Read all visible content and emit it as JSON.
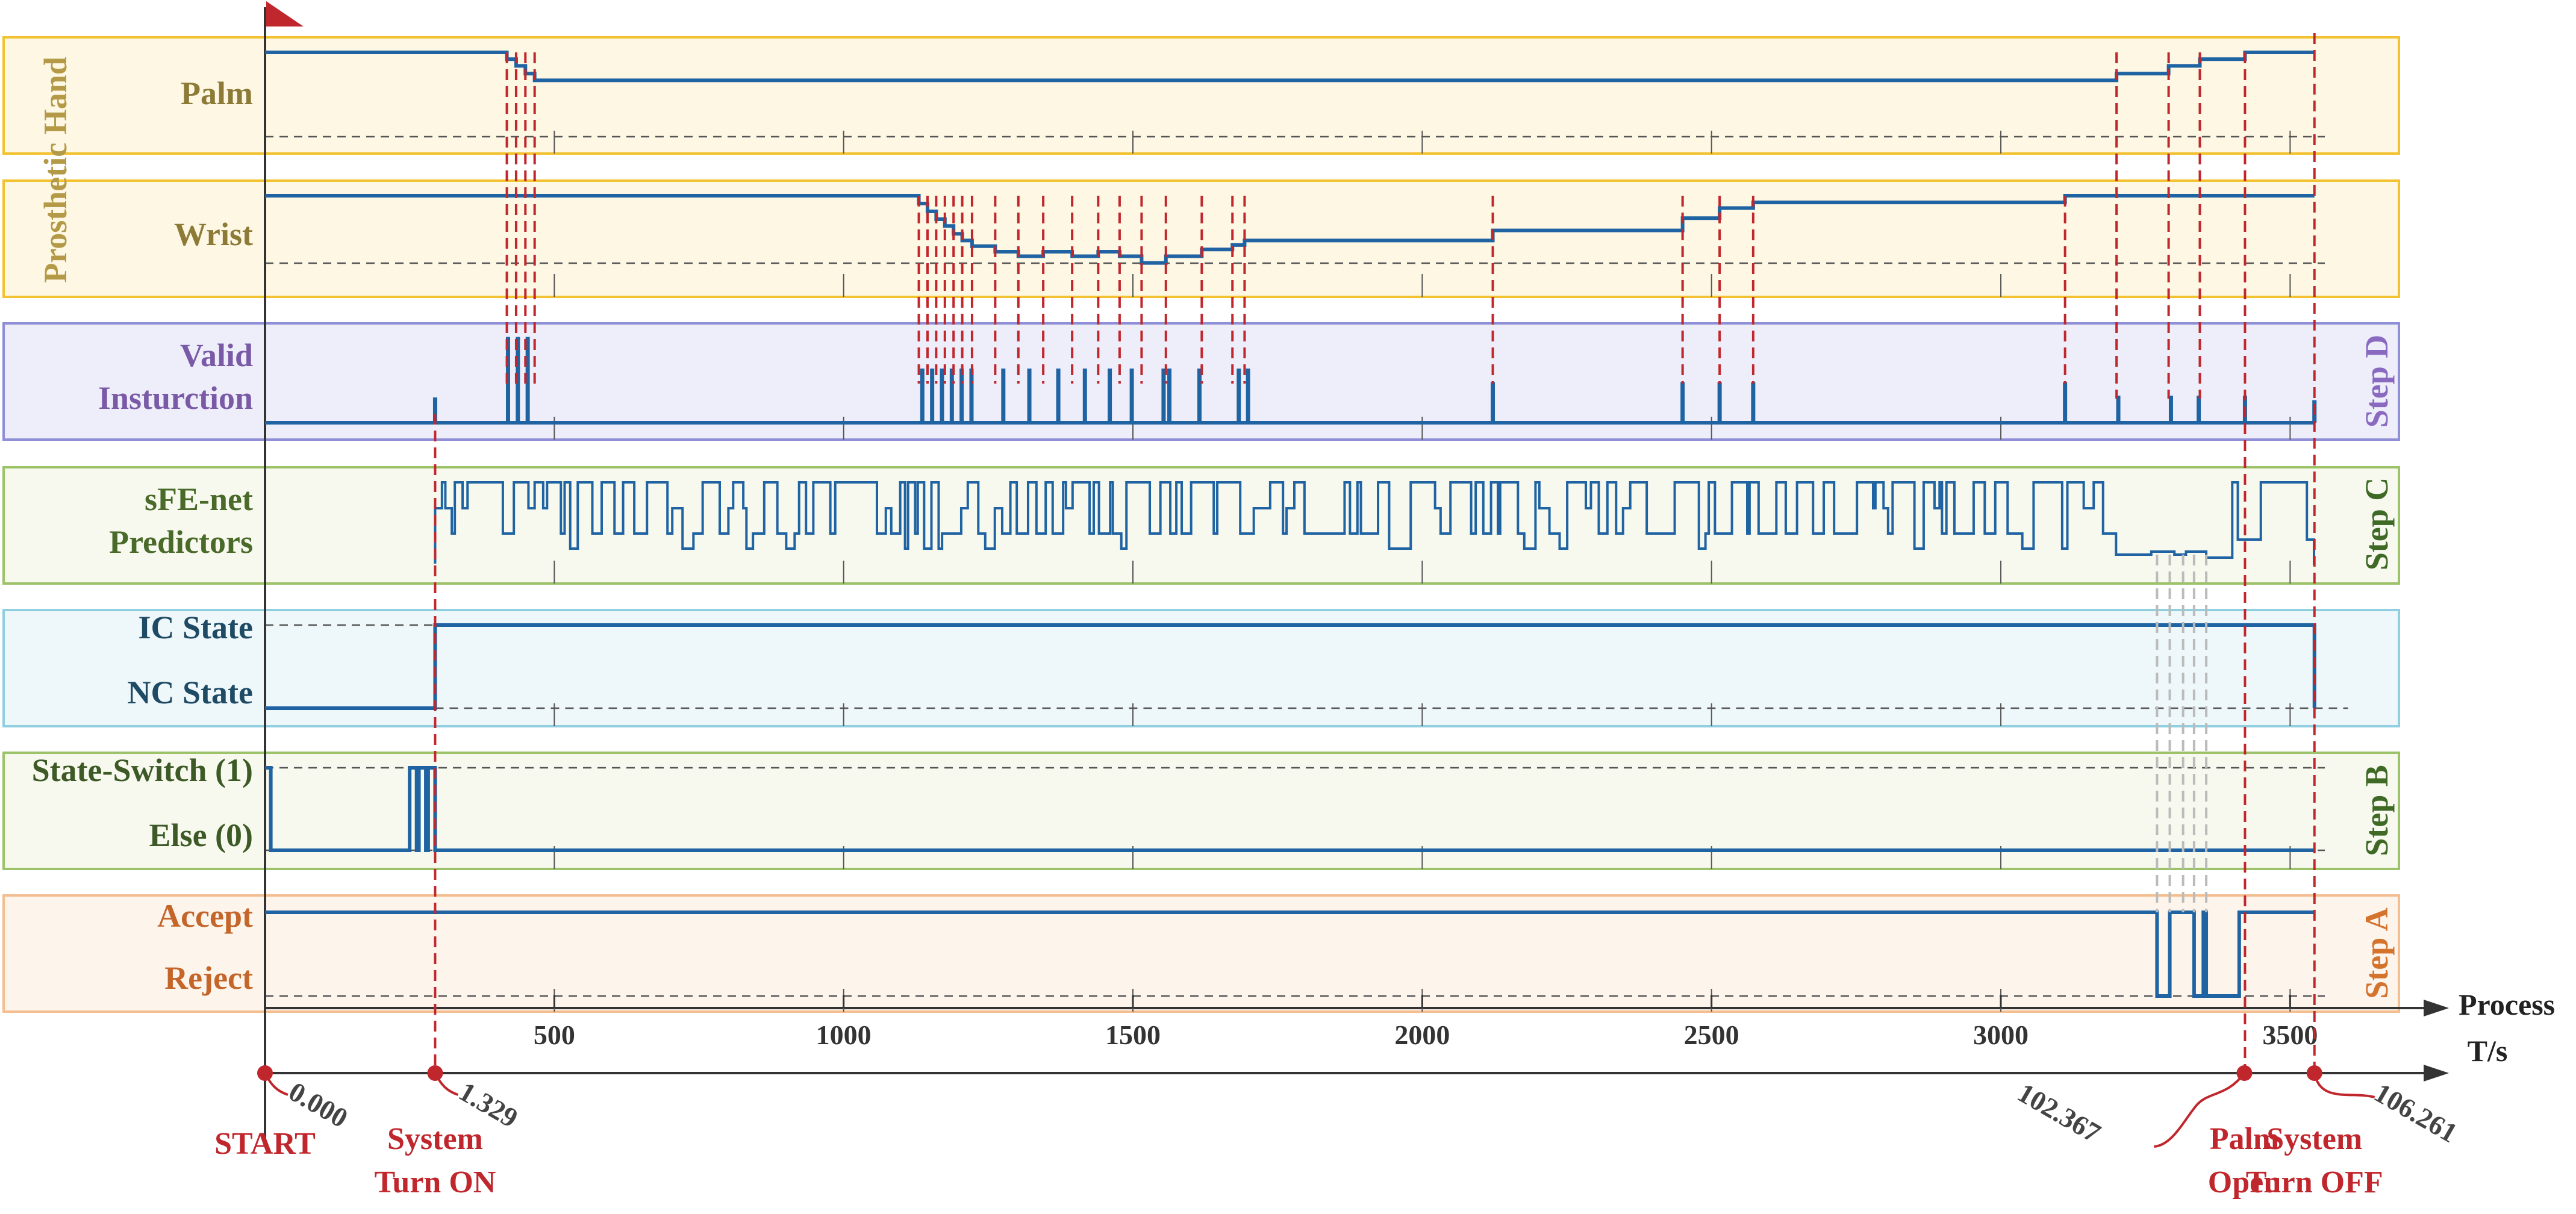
{
  "chart_data": {
    "type": "line",
    "x_axis": {
      "label": "Process",
      "ticks": [
        500,
        1000,
        1500,
        2000,
        2500,
        3000,
        3500
      ],
      "range": [
        0,
        3560
      ]
    },
    "time_axis": {
      "label": "T/s",
      "events": [
        {
          "name": "start",
          "time": "0.000",
          "label": [
            "START"
          ],
          "x": 0
        },
        {
          "name": "system-turn-on",
          "time": "1.329",
          "label": [
            "System",
            "Turn ON"
          ],
          "x": 294
        },
        {
          "name": "palm-open",
          "time": "102.367",
          "label": [
            "Palm",
            "Open"
          ],
          "x": 3421
        },
        {
          "name": "system-turn-off",
          "time": "106.261",
          "label": [
            "System",
            "Turn OFF"
          ],
          "x": 3542
        }
      ]
    },
    "groups": [
      {
        "name": "prosthetic-hand",
        "label": "Prosthetic Hand"
      },
      {
        "name": "step-d",
        "label": "Step D"
      },
      {
        "name": "step-c",
        "label": "Step C"
      },
      {
        "name": "step-b",
        "label": "Step B"
      },
      {
        "name": "step-a",
        "label": "Step A"
      }
    ],
    "rows": [
      {
        "name": "palm",
        "labels": [
          "Palm"
        ],
        "colors": {
          "fill": "#fdf7e3",
          "stroke": "#f2c230",
          "text": "#8c7a36"
        }
      },
      {
        "name": "wrist",
        "labels": [
          "Wrist"
        ],
        "colors": {
          "fill": "#fdf7e3",
          "stroke": "#f2c230",
          "text": "#8c7a36"
        }
      },
      {
        "name": "valid-instruction",
        "labels": [
          "Valid",
          "Insturction"
        ],
        "colors": {
          "fill": "#eeeefa",
          "stroke": "#8f8fd8",
          "text": "#7a5aa6"
        }
      },
      {
        "name": "sfe-net-predictors",
        "labels": [
          "sFE-net",
          "Predictors"
        ],
        "colors": {
          "fill": "#f7f9ee",
          "stroke": "#9cc26a",
          "text": "#4a6a2a"
        }
      },
      {
        "name": "ic-nc-state",
        "labels": [
          "IC State",
          "NC State"
        ],
        "colors": {
          "fill": "#eef7fa",
          "stroke": "#90cfe0",
          "text": "#1e4a64"
        }
      },
      {
        "name": "state-switch",
        "labels": [
          "State-Switch (1)",
          "Else (0)"
        ],
        "colors": {
          "fill": "#f7f9ee",
          "stroke": "#9cc26a",
          "text": "#3d5a26"
        }
      },
      {
        "name": "accept-reject",
        "labels": [
          "Accept",
          "Reject"
        ],
        "colors": {
          "fill": "#fdf4ec",
          "stroke": "#f5be90",
          "text": "#c4662a"
        }
      }
    ],
    "series": [
      {
        "name": "Palm",
        "steps": [
          [
            0,
            1.0
          ],
          [
            418,
            0.93
          ],
          [
            434,
            0.86
          ],
          [
            450,
            0.78
          ],
          [
            466,
            0.71
          ],
          [
            3200,
            0.78
          ],
          [
            3290,
            0.86
          ],
          [
            3344,
            0.93
          ],
          [
            3422,
            1.0
          ],
          [
            3542,
            1.0
          ]
        ]
      },
      {
        "name": "Wrist",
        "steps": [
          [
            0,
            1.0
          ],
          [
            1130,
            0.93
          ],
          [
            1145,
            0.86
          ],
          [
            1160,
            0.79
          ],
          [
            1175,
            0.73
          ],
          [
            1190,
            0.66
          ],
          [
            1205,
            0.6
          ],
          [
            1222,
            0.55
          ],
          [
            1262,
            0.5
          ],
          [
            1302,
            0.46
          ],
          [
            1345,
            0.5
          ],
          [
            1395,
            0.46
          ],
          [
            1440,
            0.5
          ],
          [
            1477,
            0.46
          ],
          [
            1515,
            0.4
          ],
          [
            1557,
            0.46
          ],
          [
            1619,
            0.52
          ],
          [
            1672,
            0.56
          ],
          [
            1693,
            0.6
          ],
          [
            2122,
            0.69
          ],
          [
            2450,
            0.8
          ],
          [
            2514,
            0.89
          ],
          [
            2572,
            0.94
          ],
          [
            3111,
            1.0
          ],
          [
            3542,
            1.0
          ]
        ]
      },
      {
        "name": "Valid Insturction",
        "pulses": [
          [
            294,
            0.28
          ],
          [
            420,
            0.95
          ],
          [
            437,
            0.95
          ],
          [
            454,
            0.95
          ],
          [
            1136,
            0.6
          ],
          [
            1153,
            0.6
          ],
          [
            1170,
            0.6
          ],
          [
            1187,
            0.6
          ],
          [
            1204,
            0.6
          ],
          [
            1221,
            0.6
          ],
          [
            1276,
            0.6
          ],
          [
            1321,
            0.6
          ],
          [
            1371,
            0.6
          ],
          [
            1417,
            0.6
          ],
          [
            1460,
            0.6
          ],
          [
            1498,
            0.6
          ],
          [
            1553,
            0.6
          ],
          [
            1563,
            0.6
          ],
          [
            1615,
            0.6
          ],
          [
            1683,
            0.6
          ],
          [
            1699,
            0.6
          ],
          [
            2122,
            0.45
          ],
          [
            2450,
            0.45
          ],
          [
            2514,
            0.45
          ],
          [
            2572,
            0.45
          ],
          [
            3111,
            0.45
          ],
          [
            3203,
            0.3
          ],
          [
            3294,
            0.3
          ],
          [
            3342,
            0.3
          ],
          [
            3422,
            0.3
          ],
          [
            3542,
            0.25
          ]
        ]
      },
      {
        "name": "IC State / NC State",
        "steps": [
          [
            0,
            0
          ],
          [
            294,
            1
          ],
          [
            3542,
            1
          ],
          [
            3542,
            0
          ]
        ]
      },
      {
        "name": "State-Switch (1) / Else (0)",
        "steps": [
          [
            0,
            1
          ],
          [
            10,
            0
          ],
          [
            250,
            1
          ],
          [
            262,
            0
          ],
          [
            266,
            1
          ],
          [
            278,
            0
          ],
          [
            282,
            1
          ],
          [
            294,
            0
          ],
          [
            3542,
            0
          ]
        ]
      },
      {
        "name": "Accept / Reject",
        "steps": [
          [
            0,
            1
          ],
          [
            3270,
            0
          ],
          [
            3292,
            1
          ],
          [
            3315,
            1
          ],
          [
            3334,
            0
          ],
          [
            3350,
            1
          ],
          [
            3355,
            0
          ],
          [
            3412,
            1
          ],
          [
            3422,
            1
          ],
          [
            3542,
            1
          ]
        ]
      }
    ],
    "colors": {
      "signal": "#1f63a3",
      "event": "#c0272d",
      "axis": "#333333",
      "event_gray": "#bbbbbb"
    }
  }
}
